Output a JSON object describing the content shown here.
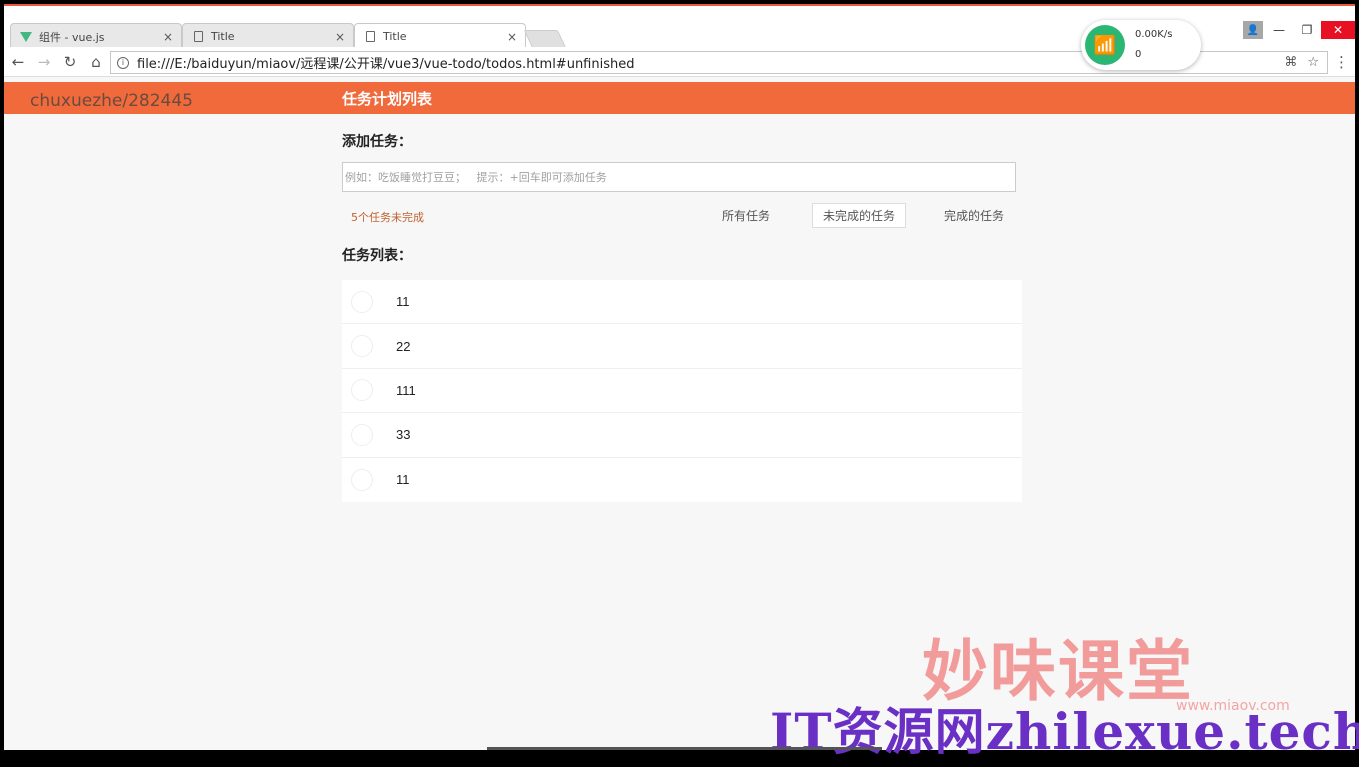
{
  "browser": {
    "tabs": [
      {
        "label": "组件 - vue.js",
        "icon": "vue-logo-icon",
        "active": false
      },
      {
        "label": "Title",
        "icon": "document-icon",
        "active": false
      },
      {
        "label": "Title",
        "icon": "document-icon",
        "active": true
      }
    ],
    "close_glyph": "×",
    "url": "file:///E:/baiduyun/miaov/远程课/公开课/vue3/vue-todo/todos.html#unfinished",
    "info_glyph": "i",
    "translate_glyph": "⌘",
    "star_glyph": "☆",
    "menu_glyph": "⋮",
    "back_glyph": "←",
    "forward_glyph": "→",
    "reload_glyph": "↻",
    "home_glyph": "⌂",
    "minimize_glyph": "—",
    "maximize_glyph": "❐",
    "window_close_glyph": "✕",
    "user_glyph": "👤"
  },
  "net_widget": {
    "speed": "0.00K/s",
    "count": "0",
    "wifi_glyph": "📶"
  },
  "app": {
    "user_watermark": "chuxuezhe/282445",
    "title": "任务计划列表",
    "add_heading": "添加任务：",
    "input_placeholder": "例如：吃饭睡觉打豆豆；   提示：+回车即可添加任务",
    "remaining_text": "5个任务未完成",
    "filters": {
      "all": "所有任务",
      "unfinished": "未完成的任务",
      "done": "完成的任务"
    },
    "active_filter": "unfinished",
    "list_heading": "任务列表：",
    "todos": [
      {
        "text": "11",
        "done": false
      },
      {
        "text": "22",
        "done": false
      },
      {
        "text": "111",
        "done": false
      },
      {
        "text": "33",
        "done": false
      },
      {
        "text": "11",
        "done": false
      }
    ]
  },
  "watermarks": {
    "brand": "妙味课堂",
    "brand_url": "www.miaov.com",
    "site": "IT资源网zhilexue.tech"
  },
  "colors": {
    "header": "#f06a3c",
    "remaining_text": "#c0622e",
    "wifi": "#2bb673"
  }
}
